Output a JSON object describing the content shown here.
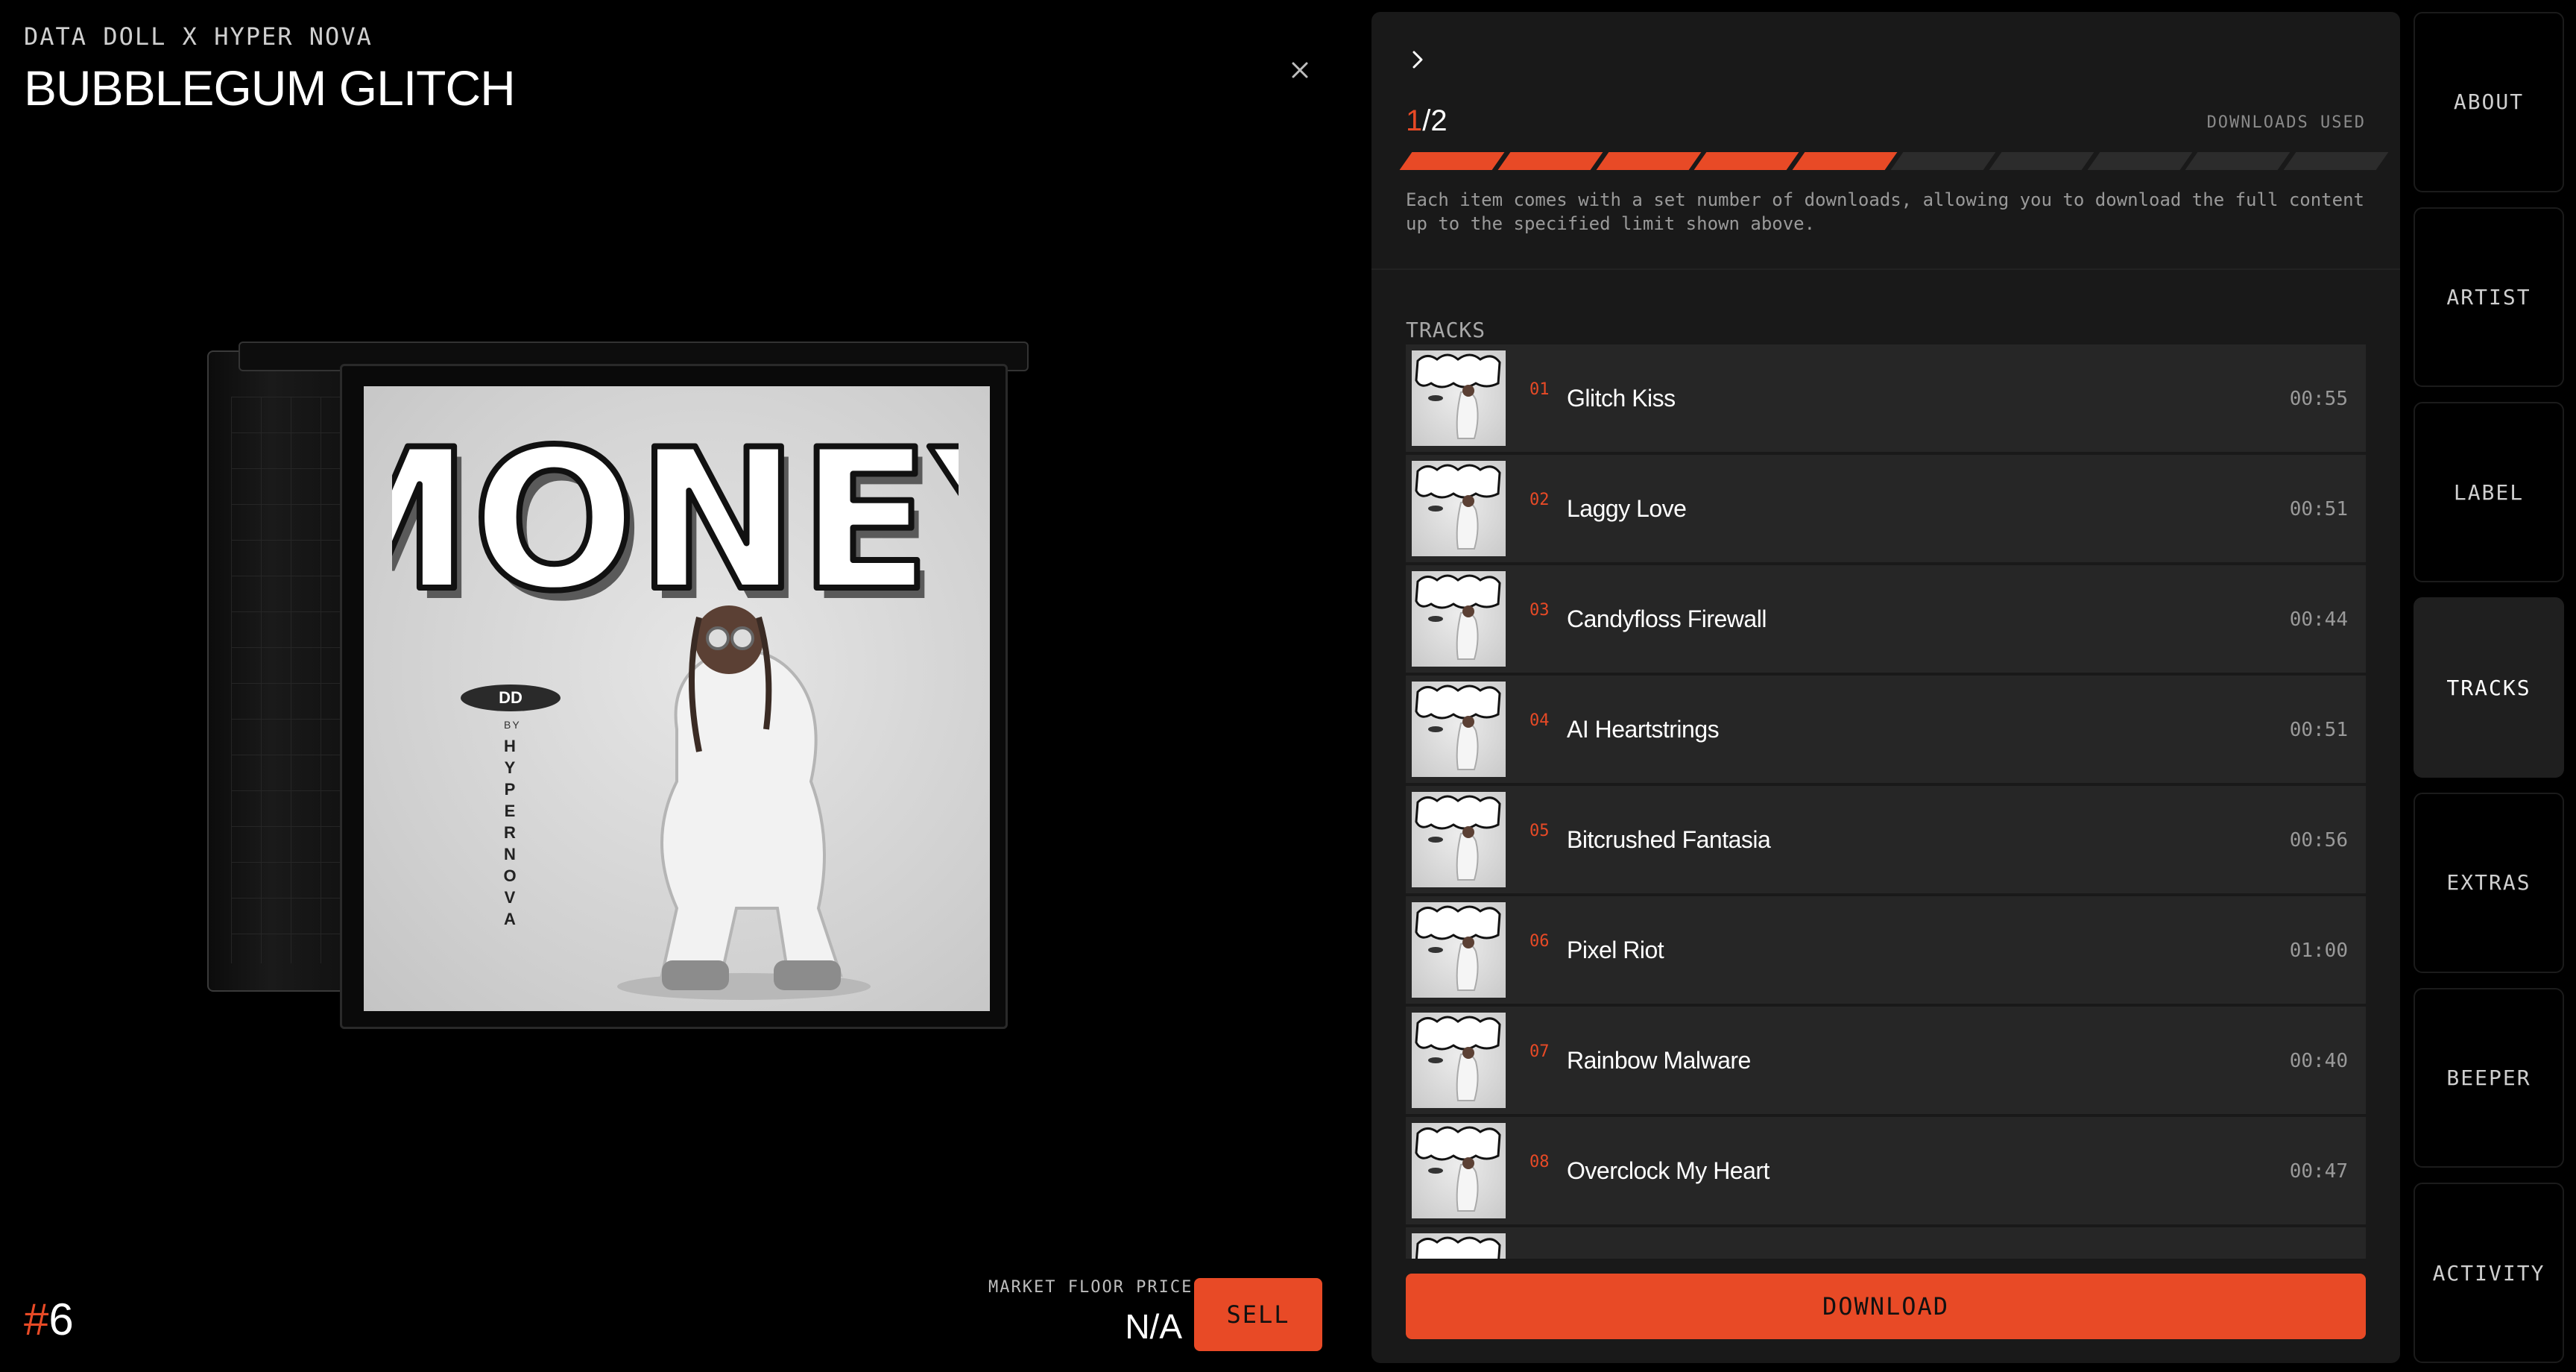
{
  "header": {
    "collection": "DATA DOLL X HYPER NOVA",
    "title": "BUBBLEGUM GLITCH"
  },
  "cover": {
    "graffiti_text": "MONEY",
    "badge": "DD",
    "by": "BY",
    "artist": "HYPERNOVA"
  },
  "footer": {
    "hash": "#",
    "token_number": "6",
    "price_label": "MARKET FLOOR PRICE",
    "price_value": "N/A",
    "sell_label": "SELL"
  },
  "downloads": {
    "used": "1",
    "separator": "/",
    "total": "2",
    "label": "DOWNLOADS USED",
    "description": "Each item comes with a set number of downloads, allowing you to download the full content up to the specified limit shown above.",
    "progress": 0.5,
    "segments": 10
  },
  "tracks_heading": "TRACKS",
  "tracks": [
    {
      "num": "01",
      "name": "Glitch Kiss",
      "duration": "00:55"
    },
    {
      "num": "02",
      "name": "Laggy Love",
      "duration": "00:51"
    },
    {
      "num": "03",
      "name": "Candyfloss Firewall",
      "duration": "00:44"
    },
    {
      "num": "04",
      "name": "AI Heartstrings",
      "duration": "00:51"
    },
    {
      "num": "05",
      "name": "Bitcrushed Fantasia",
      "duration": "00:56"
    },
    {
      "num": "06",
      "name": "Pixel Riot",
      "duration": "01:00"
    },
    {
      "num": "07",
      "name": "Rainbow Malware",
      "duration": "00:40"
    },
    {
      "num": "08",
      "name": "Overclock My Heart",
      "duration": "00:47"
    }
  ],
  "download_label": "DOWNLOAD",
  "nav": [
    {
      "label": "ABOUT",
      "active": false
    },
    {
      "label": "ARTIST",
      "active": false
    },
    {
      "label": "LABEL",
      "active": false
    },
    {
      "label": "TRACKS",
      "active": true
    },
    {
      "label": "EXTRAS",
      "active": false
    },
    {
      "label": "BEEPER",
      "active": false
    },
    {
      "label": "ACTIVITY",
      "active": false
    }
  ],
  "colors": {
    "accent": "#e84a26",
    "panel": "#191919",
    "row": "#262626"
  },
  "icons": {
    "close": "close-icon",
    "collapse": "chevron-right-icon"
  }
}
